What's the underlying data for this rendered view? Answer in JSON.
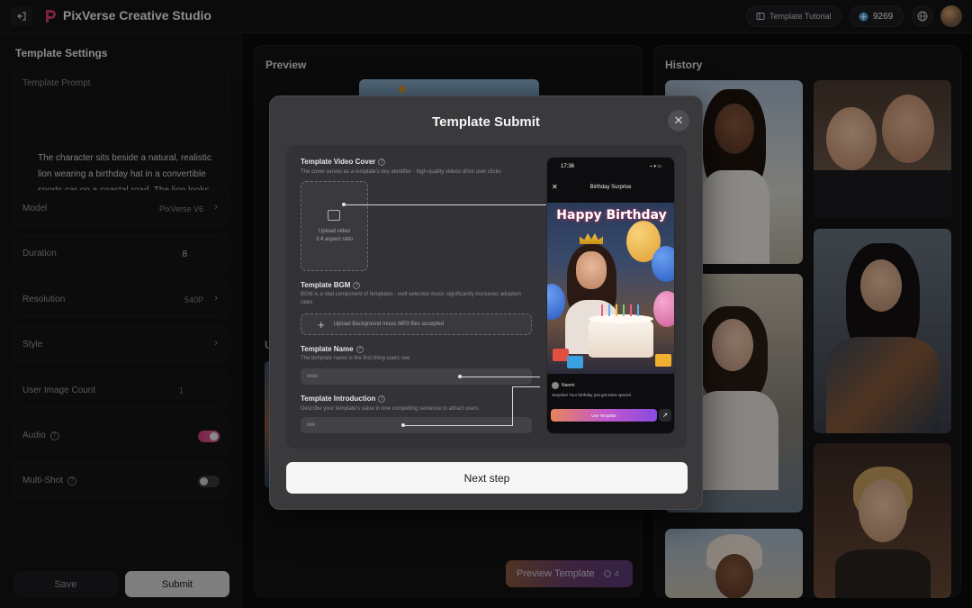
{
  "app": {
    "title": "PixVerse Creative Studio",
    "tutorial_label": "Template Tutorial",
    "credits": "9269"
  },
  "sidebar": {
    "title": "Template Settings",
    "prompt_label": "Template Prompt",
    "prompt_text": "The character sits beside a natural, realistic lion wearing a birthday hat in a convertible sports car on a coastal road. The lion looks happy and relaxed",
    "rows": [
      {
        "label": "Model",
        "value": "PixVerse V6"
      },
      {
        "label": "Duration",
        "value": "8"
      },
      {
        "label": "Resolution",
        "value": "540P"
      },
      {
        "label": "Style",
        "value": ""
      },
      {
        "label": "User Image Count",
        "value": "1"
      },
      {
        "label": "Audio",
        "toggle": true
      },
      {
        "label": "Multi-Shot",
        "toggle": false
      }
    ],
    "save_label": "Save",
    "submit_label": "Submit"
  },
  "preview": {
    "title": "Preview",
    "side_letter": "U",
    "template_button": "Preview Template",
    "template_cost": "4"
  },
  "history": {
    "title": "History"
  },
  "modal": {
    "title": "Template Submit",
    "cover_label": "Template Video Cover",
    "cover_desc": "The cover serves as a template's key identifier - high-quality videos drive user clicks",
    "upload_text_1": "Upload video",
    "upload_text_2": "3:4 aspect ratio",
    "bgm_label": "Template BGM",
    "bgm_desc": "BGM is a vital component of templates - well-selected music significantly increases adoption rates",
    "bgm_upload": "Upload Background music MP3 files accepted",
    "name_label": "Template Name",
    "name_desc": "The template name is the first thing users see",
    "name_value": "xxxx",
    "intro_label": "Template Introduction",
    "intro_desc": "Describe your template's value in one compelling sentence to attract users",
    "intro_value": "xxx",
    "next_label": "Next step",
    "phone": {
      "time": "17:36",
      "status_right": "⌁ ▾ ▭",
      "nav_title": "Birthday Surprise",
      "banner": "Happy Birthday",
      "user": "Naomi",
      "caption": "Surprise! Your birthday just got extra special",
      "cta": "Use Template"
    }
  },
  "colors": {
    "accent_pink": "#d03a7a",
    "toggle_off": "#3a3a3e",
    "modal_bg": "#3a3a3d"
  }
}
